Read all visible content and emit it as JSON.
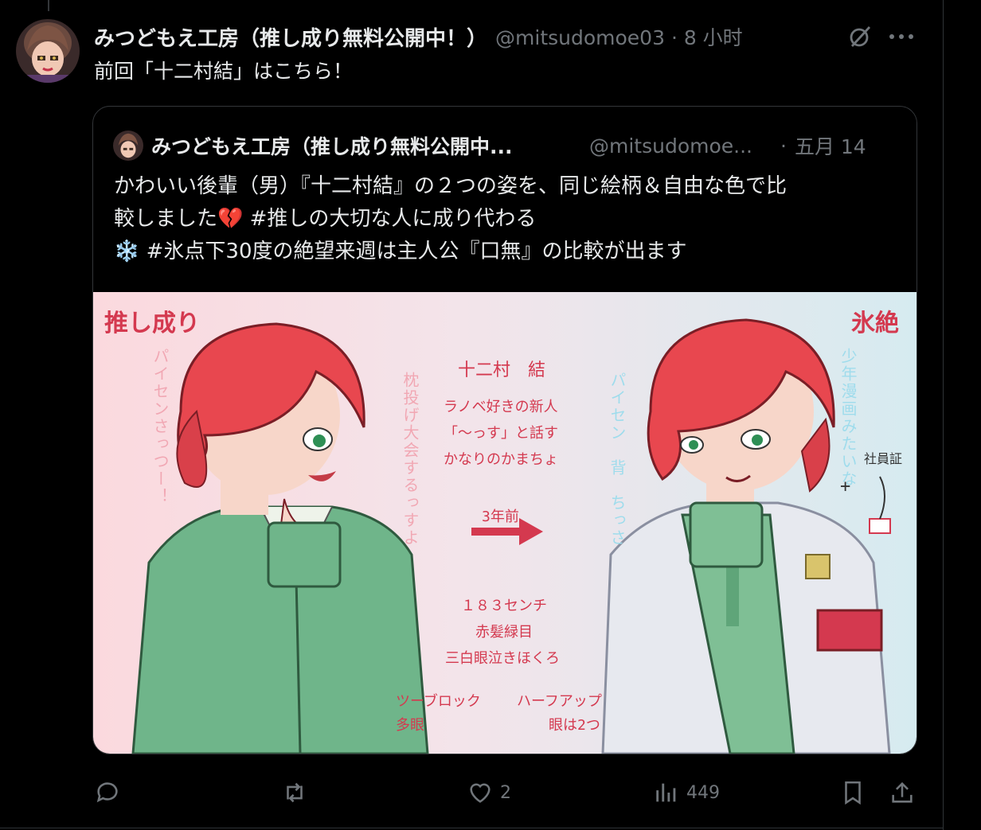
{
  "tweet": {
    "display_name": "みつどもえ工房（推し成り無料公開中！）",
    "handle_time": "@mitsudomoe03 · 8 小时",
    "text": "前回「十二村結」はこちら！"
  },
  "quote": {
    "display_name": "みつどもえ工房（推し成り無料公開中...",
    "handle": "@mitsudomoe...",
    "dot": "·",
    "time": "五月 14",
    "lines": [
      "かわいい後輩（男）『十二村結』の２つの姿を、同じ絵柄＆自由な色で比",
      "較しました💔 #推しの大切な人に成り代わる",
      "❄️ #氷点下30度の絶望来週は主人公『口無』の比較が出ます"
    ]
  },
  "art": {
    "title_left": "推し成り",
    "title_right": "氷絶",
    "name": "十二村　結",
    "desc1": "ラノベ好きの新人",
    "desc2": "「～っす」と話す",
    "desc3": "かなりのかまちょ",
    "arrow_label": "3年前",
    "stat1": "１８３センチ",
    "stat2": "赤髪緑目",
    "stat3": "三白眼泣きほくろ",
    "left_style1": "ツーブロック",
    "left_style2": "多眼",
    "right_style1": "ハーフアップ",
    "right_style2": "眼は2つ",
    "v_left1": "パイセンさっつー！",
    "v_left2": "枕投げ大会するっすよ",
    "v_right1": "パイセン　背　ちっさ",
    "v_right2": "少年漫画みたいな",
    "badge": "社員証",
    "plus": "+"
  },
  "actions": {
    "reply_count": "",
    "retweet_count": "",
    "like_count": "2",
    "view_count": "449"
  },
  "colors": {
    "bg": "#000000",
    "text": "#e7e9ea",
    "muted": "#71767b",
    "border": "#333639",
    "art_red": "#d4394f"
  }
}
